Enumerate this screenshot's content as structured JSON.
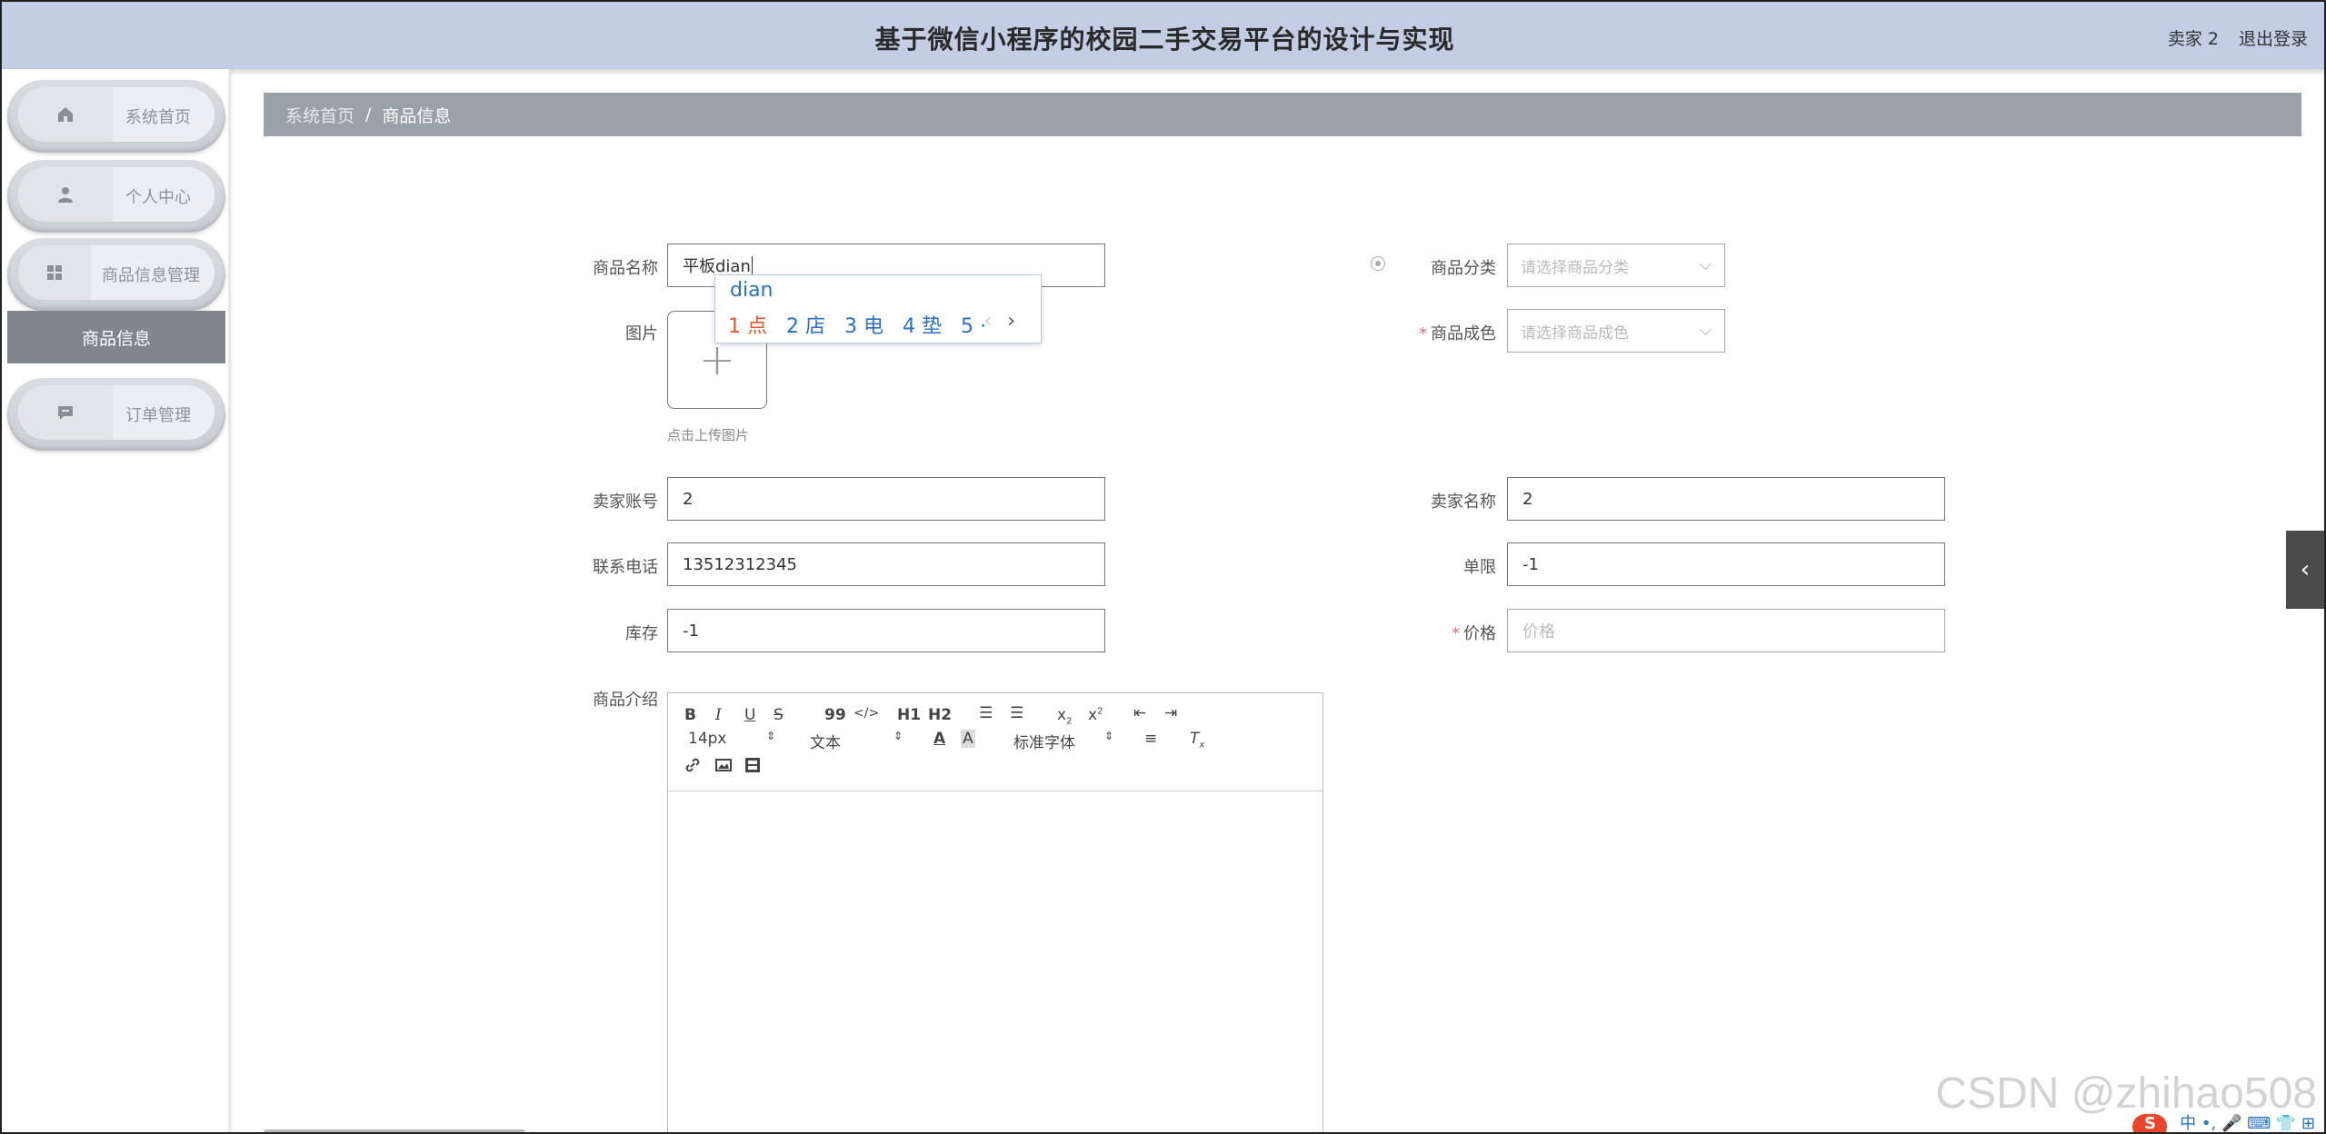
{
  "header": {
    "title": "基于微信小程序的校园二手交易平台的设计与实现",
    "user": "卖家 2",
    "logout": "退出登录"
  },
  "sidebar": {
    "items": [
      {
        "label": "系统首页",
        "icon": "home-icon"
      },
      {
        "label": "个人中心",
        "icon": "user-icon"
      },
      {
        "label": "商品信息管理",
        "icon": "grid-icon",
        "children": [
          {
            "label": "商品信息",
            "active": true
          }
        ]
      },
      {
        "label": "订单管理",
        "icon": "chat-icon"
      }
    ]
  },
  "breadcrumb": {
    "home": "系统首页",
    "separator": "/",
    "current": "商品信息"
  },
  "form": {
    "name": {
      "label": "商品名称",
      "value": "平板dian"
    },
    "category": {
      "label": "商品分类",
      "placeholder": "请选择商品分类"
    },
    "image": {
      "label": "图片",
      "upload_tip": "点击上传图片"
    },
    "condition": {
      "label": "商品成色",
      "placeholder": "请选择商品成色",
      "required": true
    },
    "seller_account": {
      "label": "卖家账号",
      "value": "2"
    },
    "seller_name": {
      "label": "卖家名称",
      "value": "2"
    },
    "phone": {
      "label": "联系电话",
      "value": "13512312345"
    },
    "limit": {
      "label": "单限",
      "value": "-1"
    },
    "stock": {
      "label": "库存",
      "value": "-1"
    },
    "price": {
      "label": "价格",
      "placeholder": "价格",
      "required": true
    },
    "intro": {
      "label": "商品介绍"
    }
  },
  "editor": {
    "font_size": "14px",
    "paragraph": "文本",
    "font_family": "标准字体",
    "buttons": [
      "B",
      "I",
      "U",
      "S",
      "99",
      "</>",
      "H1",
      "H2",
      "ordered-list",
      "bullet-list",
      "x2",
      "x2",
      "indent",
      "outdent"
    ]
  },
  "ime": {
    "pinyin": "dian",
    "candidates": [
      "1 点",
      "2 店",
      "3 电",
      "4 垫",
      "5 ·"
    ],
    "nav_prev": "‹",
    "nav_next": "›"
  },
  "watermark": "CSDN @zhihao508",
  "ime_bar": "中 •, 🎤 ⌨ 👕 ⊞",
  "colors": {
    "header_bg": "#c3cde3",
    "breadcrumb_bg": "#9aa1a9",
    "active_menu_bg": "#7f868e",
    "required": "#f56c6c",
    "ime_blue": "#2a70c7"
  }
}
